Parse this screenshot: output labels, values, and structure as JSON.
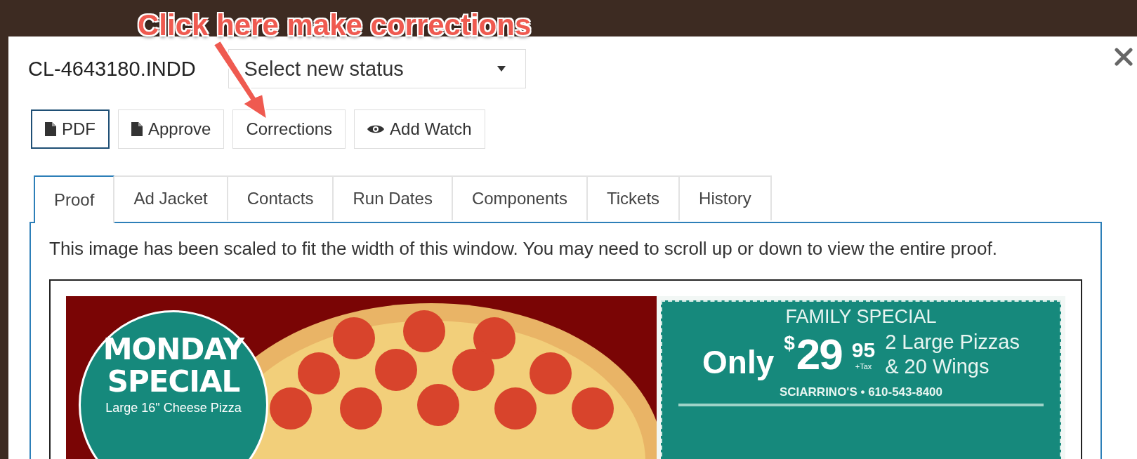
{
  "annotation": {
    "text": "Click here make corrections"
  },
  "dialog": {
    "file_name": "CL-4643180.INDD",
    "status_select": {
      "placeholder": "Select new status"
    }
  },
  "buttons": [
    {
      "label": "PDF",
      "kind": "file",
      "focused": true
    },
    {
      "label": "Approve",
      "kind": "file",
      "focused": false
    },
    {
      "label": "Corrections",
      "kind": "plain",
      "focused": false
    },
    {
      "label": "Add Watch",
      "kind": "eye",
      "focused": false
    }
  ],
  "tabs": [
    {
      "label": "Proof",
      "selected": true
    },
    {
      "label": "Ad Jacket",
      "selected": false
    },
    {
      "label": "Contacts",
      "selected": false
    },
    {
      "label": "Run Dates",
      "selected": false
    },
    {
      "label": "Components",
      "selected": false
    },
    {
      "label": "Tickets",
      "selected": false
    },
    {
      "label": "History",
      "selected": false
    }
  ],
  "proof": {
    "notice": "This image has been scaled to fit the width of this window. You may need to scroll up or down to view the entire proof.",
    "ad": {
      "badge_title": "MONDAY SPECIAL",
      "badge_subtitle": "Large 16\" Cheese Pizza",
      "coupon_title": "FAMILY SPECIAL",
      "price_prefix": "Only",
      "currency": "$",
      "price_whole": "29",
      "price_cents": "95",
      "tax": "+Tax",
      "offer_line_1": "2 Large Pizzas",
      "offer_line_2": "& 20 Wings",
      "business": "SCIARRINO'S • 610-543-8400"
    }
  }
}
